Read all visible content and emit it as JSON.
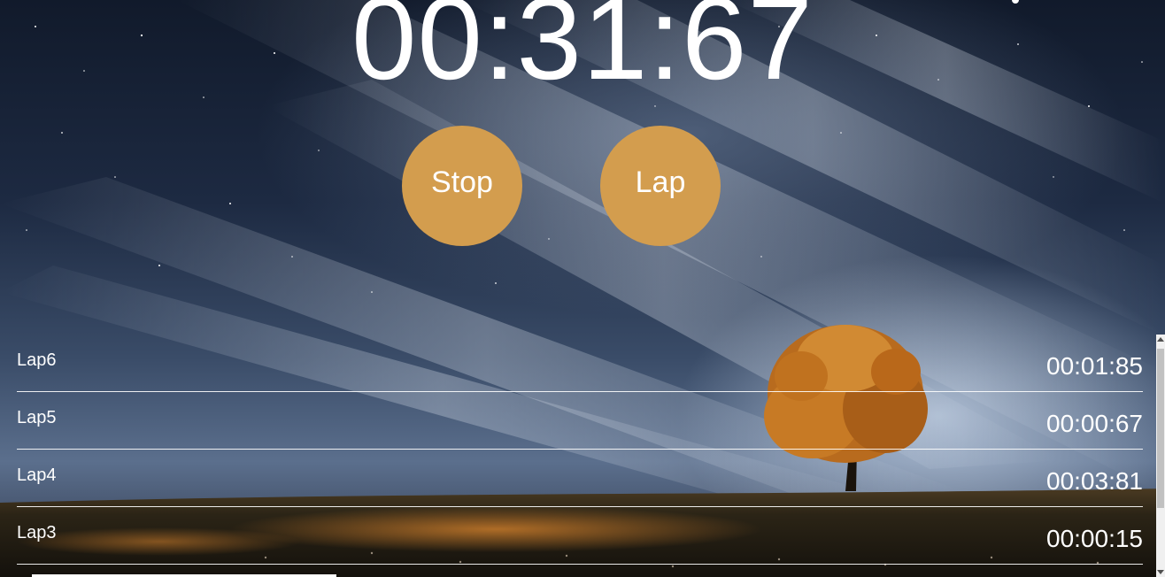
{
  "timer": {
    "display": "00:31:67"
  },
  "controls": {
    "stop_label": "Stop",
    "lap_label": "Lap",
    "button_color": "#d39d4e"
  },
  "laps": [
    {
      "name": "Lap6",
      "time": "00:01:85"
    },
    {
      "name": "Lap5",
      "time": "00:00:67"
    },
    {
      "name": "Lap4",
      "time": "00:03:81"
    },
    {
      "name": "Lap3",
      "time": "00:00:15"
    }
  ]
}
